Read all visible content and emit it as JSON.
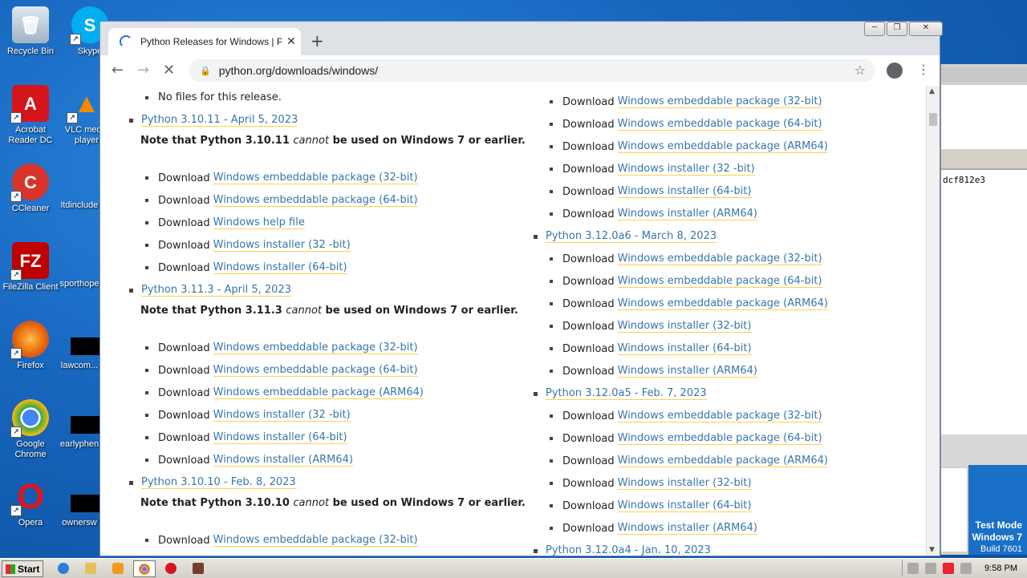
{
  "desktop": {
    "icons": [
      {
        "label": "Recycle Bin"
      },
      {
        "label": "Skype"
      },
      {
        "label": "Acrobat Reader DC"
      },
      {
        "label": "VLC media player"
      },
      {
        "label": "CCleaner"
      },
      {
        "label": "ltdinclude"
      },
      {
        "label": "FileZilla Client"
      },
      {
        "label": "sporthope"
      },
      {
        "label": "Firefox"
      },
      {
        "label": "lawcom..."
      },
      {
        "label": "Google Chrome"
      },
      {
        "label": "earlyphen"
      },
      {
        "label": "Opera"
      },
      {
        "label": "ownersw"
      }
    ],
    "bg_window_hash": "dcf812e3",
    "testmode": {
      "line1": "Test Mode",
      "line2": "Windows 7",
      "line3": "Build 7601"
    }
  },
  "browser": {
    "tab_title": "Python Releases for Windows | Pyth",
    "new_tab_label": "+",
    "url": "python.org/downloads/windows/",
    "window_buttons": [
      "─",
      "❐",
      "✕"
    ]
  },
  "page": {
    "download_prefix": "Download",
    "left": {
      "top_item": "No files for this release.",
      "releases": [
        {
          "title": "Python 3.10.11 - April 5, 2023",
          "note_pre": "Note that Python 3.10.11 ",
          "note_em": "cannot",
          "note_post": " be used on Windows 7 or earlier.",
          "files": [
            "Windows embeddable package (32-bit)",
            "Windows embeddable package (64-bit)",
            "Windows help file",
            "Windows installer (32 -bit)",
            "Windows installer (64-bit)"
          ]
        },
        {
          "title": "Python 3.11.3 - April 5, 2023",
          "note_pre": "Note that Python 3.11.3 ",
          "note_em": "cannot",
          "note_post": " be used on Windows 7 or earlier.",
          "files": [
            "Windows embeddable package (32-bit)",
            "Windows embeddable package (64-bit)",
            "Windows embeddable package (ARM64)",
            "Windows installer (32 -bit)",
            "Windows installer (64-bit)",
            "Windows installer (ARM64)"
          ]
        },
        {
          "title": "Python 3.10.10 - Feb. 8, 2023",
          "note_pre": "Note that Python 3.10.10 ",
          "note_em": "cannot",
          "note_post": " be used on Windows 7 or earlier.",
          "files": [
            "Windows embeddable package (32-bit)"
          ]
        }
      ]
    },
    "right": {
      "top_files": [
        "Windows embeddable package (32-bit)",
        "Windows embeddable package (64-bit)",
        "Windows embeddable package (ARM64)",
        "Windows installer (32 -bit)",
        "Windows installer (64-bit)",
        "Windows installer (ARM64)"
      ],
      "releases": [
        {
          "title": "Python 3.12.0a6 - March 8, 2023",
          "files": [
            "Windows embeddable package (32-bit)",
            "Windows embeddable package (64-bit)",
            "Windows embeddable package (ARM64)",
            "Windows installer (32-bit)",
            "Windows installer (64-bit)",
            "Windows installer (ARM64)"
          ]
        },
        {
          "title": "Python 3.12.0a5 - Feb. 7, 2023",
          "files": [
            "Windows embeddable package (32-bit)",
            "Windows embeddable package (64-bit)",
            "Windows embeddable package (ARM64)",
            "Windows installer (32-bit)",
            "Windows installer (64-bit)",
            "Windows installer (ARM64)"
          ]
        },
        {
          "title": "Python 3.12.0a4 - Jan. 10, 2023",
          "files": []
        }
      ]
    }
  },
  "taskbar": {
    "start_label": "Start",
    "clock": "9:58 PM"
  }
}
